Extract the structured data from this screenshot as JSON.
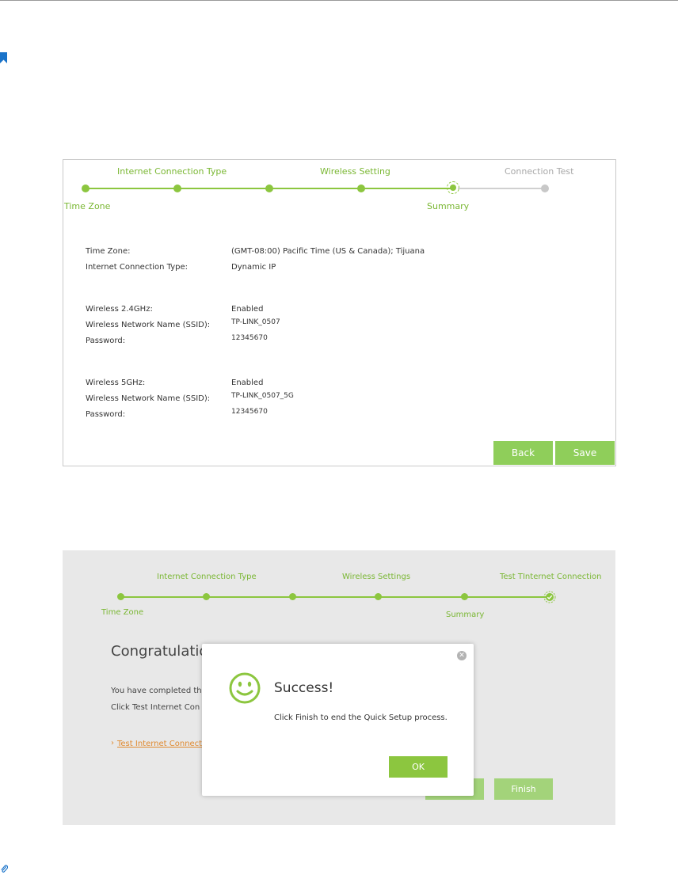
{
  "colors": {
    "accent": "#8cc63f",
    "inactive": "#c8c8c8",
    "link": "#e08a30"
  },
  "summary_wizard": {
    "steps_top": [
      "Internet Connection Type",
      "Wireless Setting",
      "Connection Test"
    ],
    "steps_bottom": [
      "Time Zone",
      "Summary"
    ],
    "rows": [
      {
        "label": "Time Zone:",
        "value": "(GMT-08:00) Pacific Time (US & Canada); Tijuana"
      },
      {
        "label": "Internet Connection Type:",
        "value": "Dynamic IP"
      },
      {
        "label": "Wireless 2.4GHz:",
        "value": "Enabled"
      },
      {
        "label": "Wireless Network Name (SSID):",
        "value": "TP-LINK_0507"
      },
      {
        "label": "Password:",
        "value": "12345670"
      },
      {
        "label": "Wireless 5GHz:",
        "value": "Enabled"
      },
      {
        "label": "Wireless Network Name (SSID):",
        "value": "TP-LINK_0507_5G"
      },
      {
        "label": "Password:",
        "value": "12345670"
      }
    ],
    "back_label": "Back",
    "save_label": "Save"
  },
  "finish_wizard": {
    "steps_top": [
      "Internet Connection Type",
      "Wireless Settings",
      "Test TInternet Connection"
    ],
    "steps_bottom": [
      "Time Zone",
      "Summary"
    ],
    "heading": "Congratulatio",
    "para1": "You have completed th",
    "para2": "Click Test Internet Con",
    "link_text": "Test Internet Connect",
    "finish_label": "Finish"
  },
  "modal": {
    "title": "Success!",
    "message": "Click Finish to end the Quick Setup process.",
    "ok_label": "OK",
    "close_icon": "close-icon"
  }
}
